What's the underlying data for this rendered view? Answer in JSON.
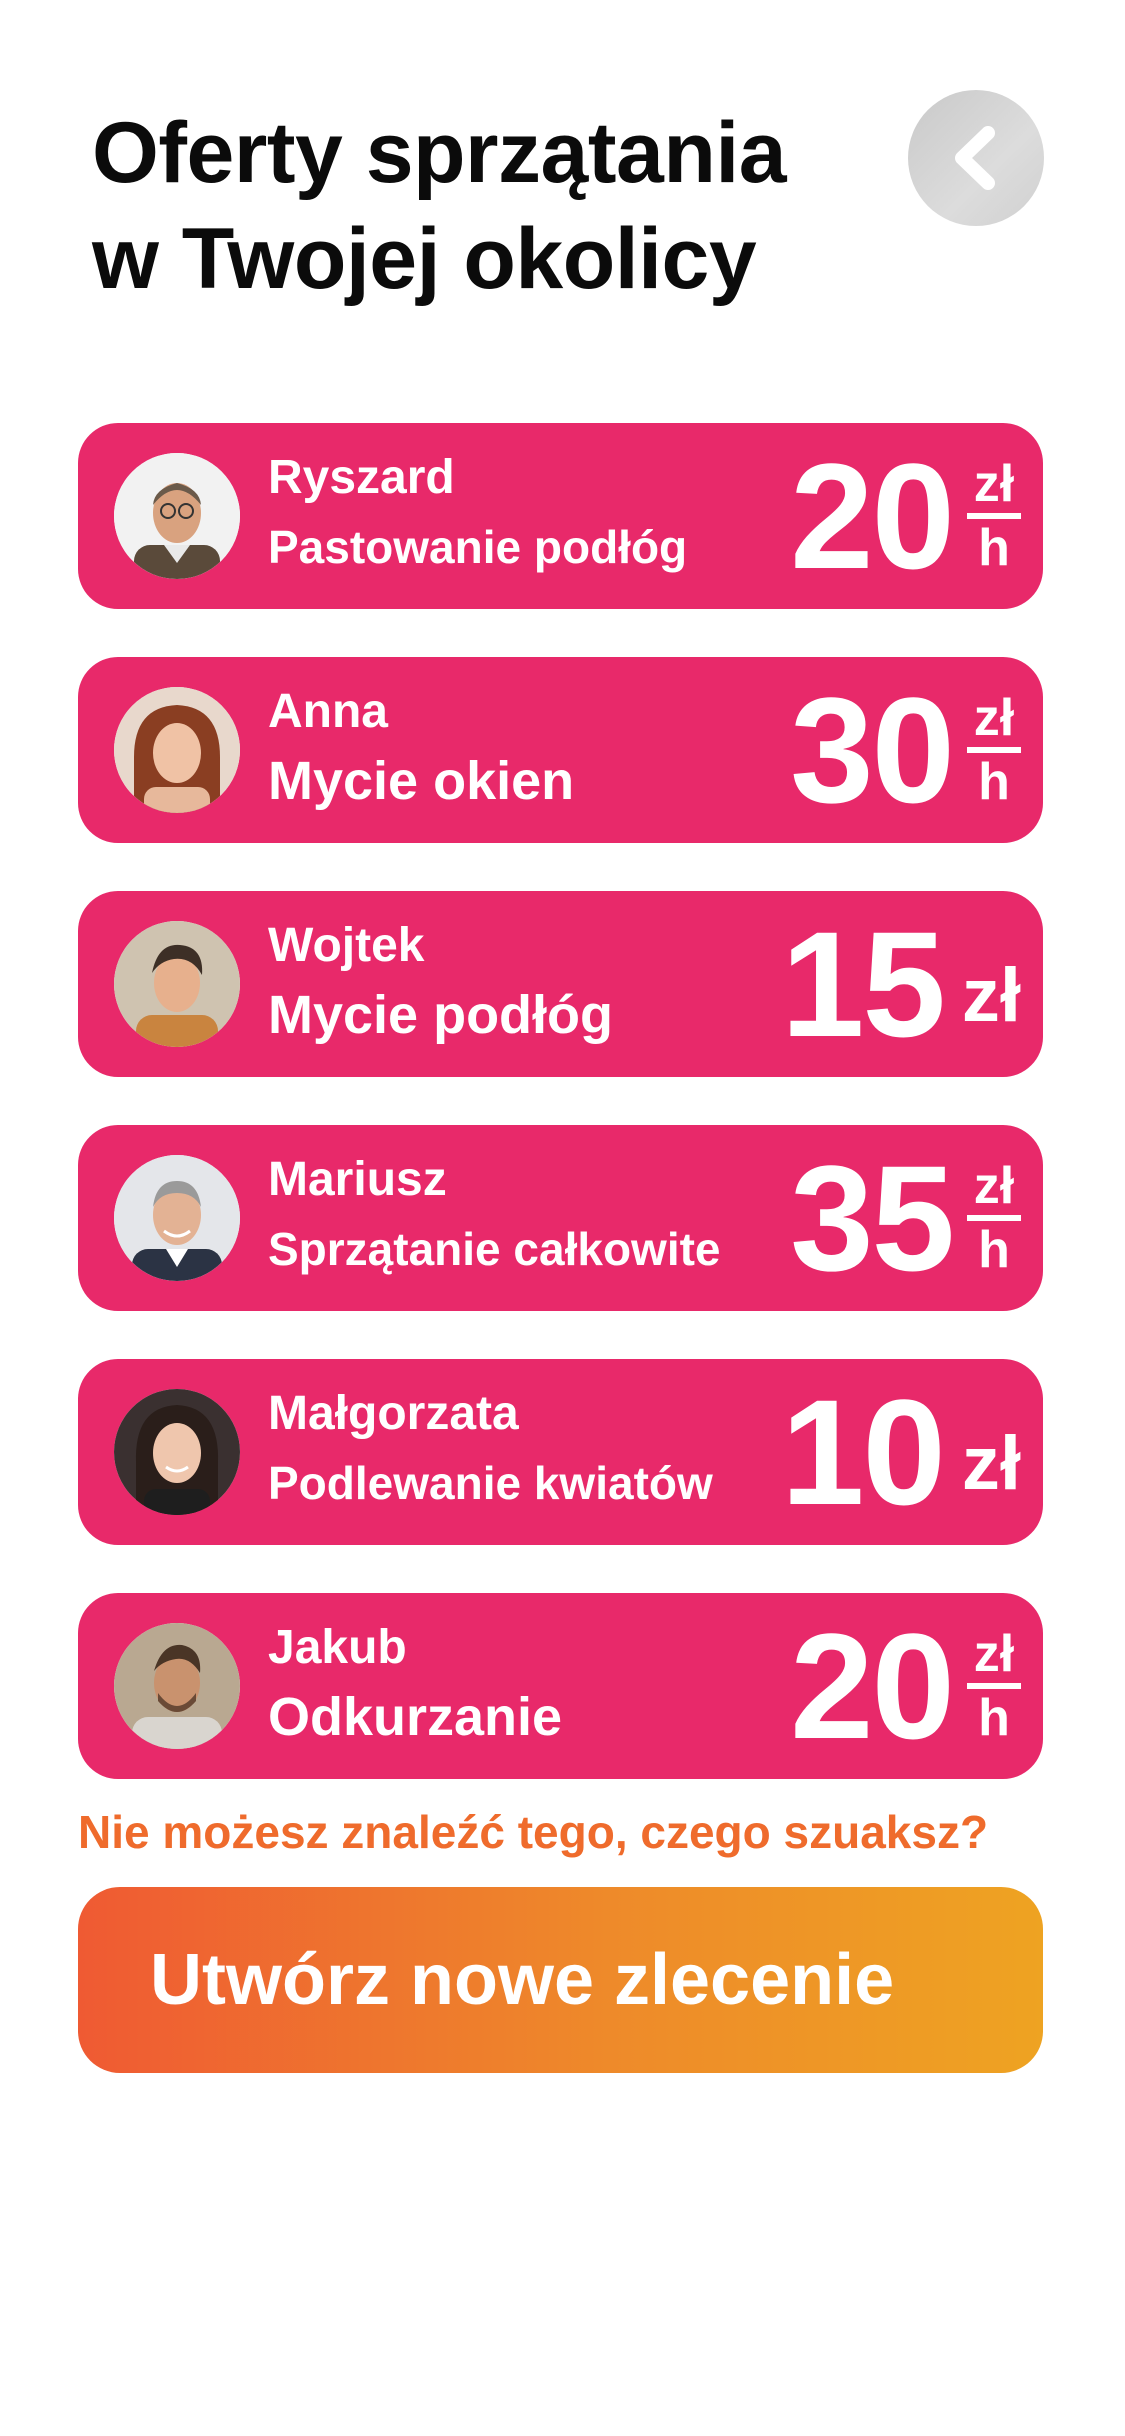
{
  "header": {
    "title_line1": "Oferty sprzątania",
    "title_line2": "w Twojej okolicy",
    "back_icon": "chevron-left-icon"
  },
  "offers": [
    {
      "name": "Ryszard",
      "service": "Pastowanie podłóg",
      "amount": "20",
      "unit_top": "zł",
      "unit_bottom": "h",
      "per_hour": true
    },
    {
      "name": "Anna",
      "service": "Mycie okien",
      "amount": "30",
      "unit_top": "zł",
      "unit_bottom": "h",
      "per_hour": true
    },
    {
      "name": "Wojtek",
      "service": "Mycie podłóg",
      "amount": "15",
      "unit": "zł",
      "per_hour": false
    },
    {
      "name": "Mariusz",
      "service": "Sprzątanie całkowite",
      "amount": "35",
      "unit_top": "zł",
      "unit_bottom": "h",
      "per_hour": true
    },
    {
      "name": "Małgorzata",
      "service": "Podlewanie kwiatów",
      "amount": "10",
      "unit": "zł",
      "per_hour": false
    },
    {
      "name": "Jakub",
      "service": "Odkurzanie",
      "amount": "20",
      "unit_top": "zł",
      "unit_bottom": "h",
      "per_hour": true
    }
  ],
  "footer": {
    "hint": "Nie możesz znaleźć tego, czego szuaksz?",
    "cta_label": "Utwórz nowe zlecenie"
  },
  "colors": {
    "card": "#e8296a",
    "hint": "#ef6b2c",
    "cta_start": "#ef5a33",
    "cta_end": "#eea322"
  }
}
